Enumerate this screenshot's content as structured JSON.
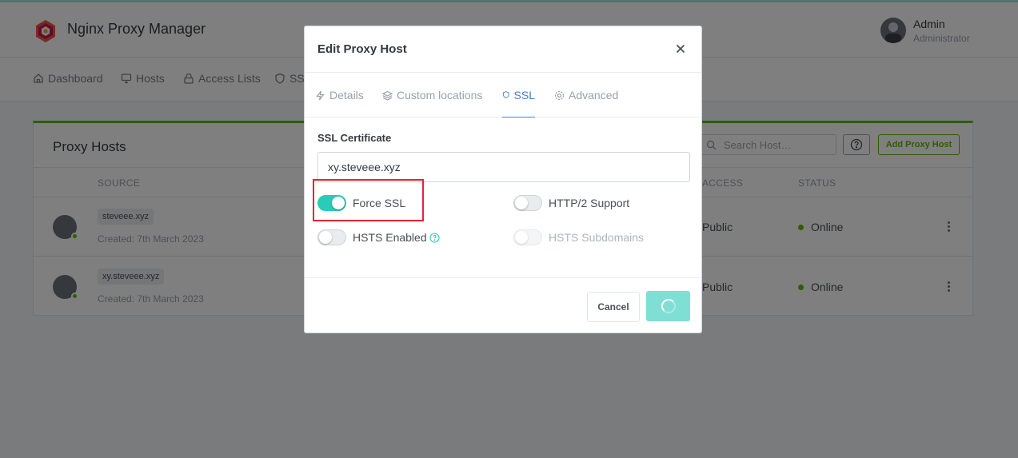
{
  "app": {
    "brand": "Nginx Proxy Manager",
    "user_name": "Admin",
    "user_role": "Administrator"
  },
  "nav": {
    "items": [
      {
        "label": "Dashboard",
        "icon": "home-icon"
      },
      {
        "label": "Hosts",
        "icon": "monitor-icon"
      },
      {
        "label": "Access Lists",
        "icon": "lock-icon"
      },
      {
        "label": "SSL",
        "icon": "shield-icon"
      }
    ]
  },
  "card": {
    "title": "Proxy Hosts",
    "search_placeholder": "Search Host…",
    "add_button": "Add Proxy Host",
    "columns": {
      "source": "SOURCE",
      "access": "ACCESS",
      "status": "STATUS"
    },
    "rows": [
      {
        "domain": "steveee.xyz",
        "created": "Created: 7th March 2023",
        "access": "Public",
        "status": "Online"
      },
      {
        "domain": "xy.steveee.xyz",
        "created": "Created: 7th March 2023",
        "access": "Public",
        "status": "Online"
      }
    ]
  },
  "modal": {
    "title": "Edit Proxy Host",
    "tabs": [
      {
        "label": "Details",
        "icon": "zap-icon"
      },
      {
        "label": "Custom locations",
        "icon": "layers-icon"
      },
      {
        "label": "SSL",
        "icon": "shield-icon",
        "active": true
      },
      {
        "label": "Advanced",
        "icon": "settings-icon"
      }
    ],
    "ssl_label": "SSL Certificate",
    "ssl_value": "xy.steveee.xyz",
    "toggles": {
      "force_ssl": {
        "label": "Force SSL",
        "on": true
      },
      "http2": {
        "label": "HTTP/2 Support",
        "on": false
      },
      "hsts": {
        "label": "HSTS Enabled",
        "on": false
      },
      "hsts_sub": {
        "label": "HSTS Subdomains",
        "on": false,
        "disabled": true
      }
    },
    "cancel_label": "Cancel"
  },
  "colors": {
    "accent_teal": "#2bcbba",
    "active_tab": "#467fcf",
    "highlight": "#e1253a",
    "online": "#5eba00"
  }
}
